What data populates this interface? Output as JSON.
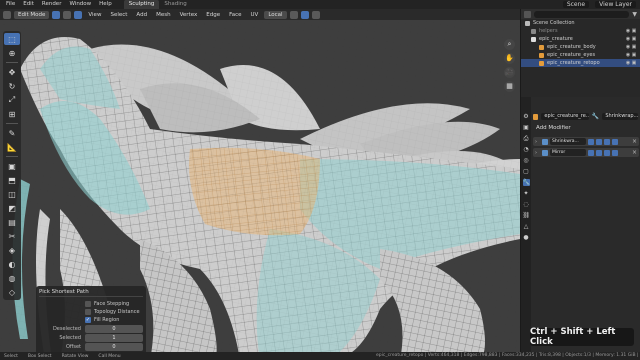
{
  "topbar": {
    "menus": [
      "File",
      "Edit",
      "Render",
      "Window",
      "Help"
    ],
    "workspace_tabs": [
      "Sculpting",
      "Shading"
    ],
    "active_tab": "Sculpting",
    "scene_label": "Scene",
    "view_layer_label": "View Layer"
  },
  "viewport": {
    "mode": "Edit Mode",
    "menus": [
      "View",
      "Select",
      "Add",
      "Mesh",
      "Vertex",
      "Edge",
      "Face",
      "UV"
    ],
    "transform_orientation": "Local"
  },
  "toolbar": {
    "tools": [
      "select-box-icon",
      "cursor-icon",
      "move-icon",
      "rotate-icon",
      "scale-icon",
      "transform-icon",
      "annotate-icon",
      "measure-icon",
      "add-cube-icon",
      "extrude-icon",
      "inset-icon",
      "bevel-icon",
      "loopcut-icon",
      "knife-icon",
      "polybuild-icon",
      "spin-icon",
      "smooth-icon",
      "shrink-icon",
      "shear-icon",
      "rip-icon"
    ]
  },
  "operator_panel": {
    "title": "Pick Shortest Path",
    "face_stepping": "Face Stepping",
    "topology_distance": "Topology Distance",
    "fill_region": "Fill Region",
    "fill_region_checked": true,
    "deselected_label": "Deselected",
    "deselected_value": "0",
    "selected_label": "Selected",
    "selected_value": "1",
    "offset_label": "Offset",
    "offset_value": "0"
  },
  "shortcut_overlay": "Ctrl + Shift + Left Click",
  "statusbar": {
    "items": [
      "Select",
      "Box Select",
      "Rotate View",
      "Call Menu"
    ],
    "stats": "epic_creature_retopo | Verts:464,318 | Edges:798,883 | Faces:334,235 | Tris:8,398 | Objects:1/3 | Memory: 1.31 GiB | 3.0.0 Alpha"
  },
  "outliner": {
    "root": "Scene Collection",
    "items": [
      {
        "name": "helpers",
        "indent": 0
      },
      {
        "name": "epic_creature",
        "indent": 0
      },
      {
        "name": "epic_creature_body",
        "indent": 1
      },
      {
        "name": "epic_creature_eyes",
        "indent": 1
      },
      {
        "name": "epic_creature_retopo",
        "indent": 1,
        "selected": true
      }
    ]
  },
  "properties": {
    "object_name": "epic_creature_re...",
    "modifier_name": "Shrinkwrap...",
    "add_modifier": "Add Modifier",
    "modifiers": [
      "Shrinkwra...",
      "Mirror"
    ]
  },
  "colors": {
    "accent": "#4772b3",
    "mesh_base": "#cfcfcf",
    "mesh_teal": "#8fd0d0",
    "selection_orange": "#f0b46a"
  }
}
